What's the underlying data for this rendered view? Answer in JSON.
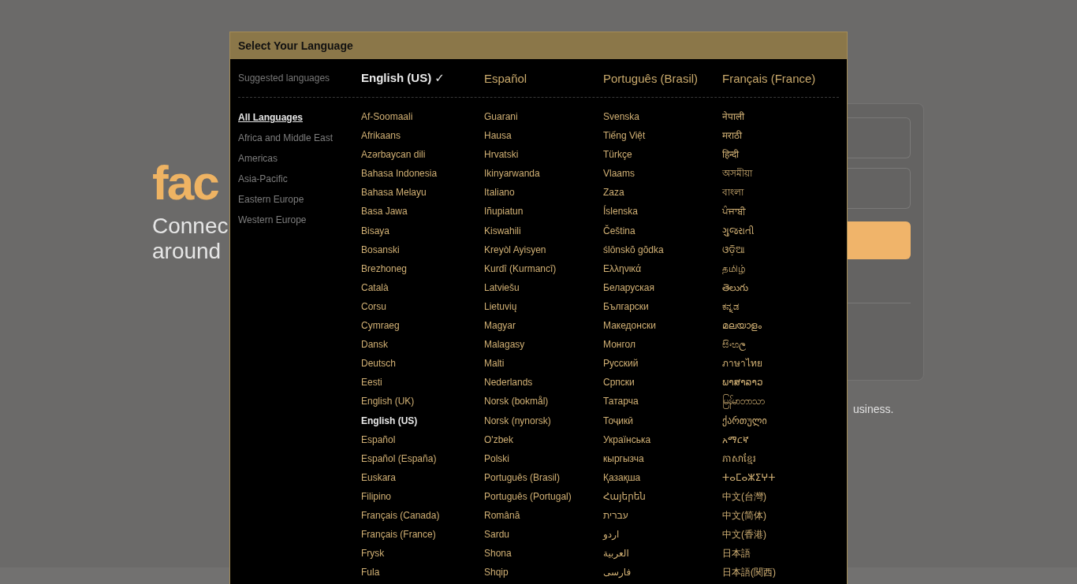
{
  "background": {
    "logo": "fac",
    "tagline": [
      "Connec",
      "around"
    ],
    "footer_text": "usiness."
  },
  "dialog": {
    "title": "Select Your Language",
    "suggested": {
      "label": "Suggested languages",
      "items": [
        {
          "label": "English (US) ✓",
          "selected": true
        },
        {
          "label": "Español",
          "selected": false
        },
        {
          "label": "Português (Brasil)",
          "selected": false
        },
        {
          "label": "Français (France)",
          "selected": false
        }
      ]
    },
    "sidebar": {
      "items": [
        {
          "label": "All Languages",
          "selected": true
        },
        {
          "label": "Africa and Middle East",
          "selected": false
        },
        {
          "label": "Americas",
          "selected": false
        },
        {
          "label": "Asia-Pacific",
          "selected": false
        },
        {
          "label": "Eastern Europe",
          "selected": false
        },
        {
          "label": "Western Europe",
          "selected": false
        }
      ]
    },
    "columns": [
      {
        "items": [
          {
            "label": "Af-Soomaali",
            "selected": false
          },
          {
            "label": "Afrikaans",
            "selected": false
          },
          {
            "label": "Azərbaycan dili",
            "selected": false
          },
          {
            "label": "Bahasa Indonesia",
            "selected": false
          },
          {
            "label": "Bahasa Melayu",
            "selected": false
          },
          {
            "label": "Basa Jawa",
            "selected": false
          },
          {
            "label": "Bisaya",
            "selected": false
          },
          {
            "label": "Bosanski",
            "selected": false
          },
          {
            "label": "Brezhoneg",
            "selected": false
          },
          {
            "label": "Català",
            "selected": false
          },
          {
            "label": "Corsu",
            "selected": false
          },
          {
            "label": "Cymraeg",
            "selected": false
          },
          {
            "label": "Dansk",
            "selected": false
          },
          {
            "label": "Deutsch",
            "selected": false
          },
          {
            "label": "Eesti",
            "selected": false
          },
          {
            "label": "English (UK)",
            "selected": false
          },
          {
            "label": "English (US)",
            "selected": true
          },
          {
            "label": "Español",
            "selected": false
          },
          {
            "label": "Español (España)",
            "selected": false
          },
          {
            "label": "Euskara",
            "selected": false
          },
          {
            "label": "Filipino",
            "selected": false
          },
          {
            "label": "Français (Canada)",
            "selected": false
          },
          {
            "label": "Français (France)",
            "selected": false
          },
          {
            "label": "Frysk",
            "selected": false
          },
          {
            "label": "Fula",
            "selected": false
          }
        ]
      },
      {
        "items": [
          {
            "label": "Guarani",
            "selected": false
          },
          {
            "label": "Hausa",
            "selected": false
          },
          {
            "label": "Hrvatski",
            "selected": false
          },
          {
            "label": "Ikinyarwanda",
            "selected": false
          },
          {
            "label": "Italiano",
            "selected": false
          },
          {
            "label": "Iñupiatun",
            "selected": false
          },
          {
            "label": "Kiswahili",
            "selected": false
          },
          {
            "label": "Kreyòl Ayisyen",
            "selected": false
          },
          {
            "label": "Kurdî (Kurmancî)",
            "selected": false
          },
          {
            "label": "Latviešu",
            "selected": false
          },
          {
            "label": "Lietuvių",
            "selected": false
          },
          {
            "label": "Magyar",
            "selected": false
          },
          {
            "label": "Malagasy",
            "selected": false
          },
          {
            "label": "Malti",
            "selected": false
          },
          {
            "label": "Nederlands",
            "selected": false
          },
          {
            "label": "Norsk (bokmål)",
            "selected": false
          },
          {
            "label": "Norsk (nynorsk)",
            "selected": false
          },
          {
            "label": "O'zbek",
            "selected": false
          },
          {
            "label": "Polski",
            "selected": false
          },
          {
            "label": "Português (Brasil)",
            "selected": false
          },
          {
            "label": "Português (Portugal)",
            "selected": false
          },
          {
            "label": "Română",
            "selected": false
          },
          {
            "label": "Sardu",
            "selected": false
          },
          {
            "label": "Shona",
            "selected": false
          },
          {
            "label": "Shqip",
            "selected": false
          }
        ]
      },
      {
        "items": [
          {
            "label": "Svenska",
            "selected": false
          },
          {
            "label": "Tiếng Việt",
            "selected": false
          },
          {
            "label": "Türkçe",
            "selected": false
          },
          {
            "label": "Vlaams",
            "selected": false
          },
          {
            "label": "Zaza",
            "selected": false
          },
          {
            "label": "Íslenska",
            "selected": false
          },
          {
            "label": "Čeština",
            "selected": false
          },
          {
            "label": "ślōnskŏ gŏdka",
            "selected": false
          },
          {
            "label": "Ελληνικά",
            "selected": false
          },
          {
            "label": "Беларуская",
            "selected": false
          },
          {
            "label": "Български",
            "selected": false
          },
          {
            "label": "Македонски",
            "selected": false
          },
          {
            "label": "Монгол",
            "selected": false
          },
          {
            "label": "Русский",
            "selected": false
          },
          {
            "label": "Српски",
            "selected": false
          },
          {
            "label": "Татарча",
            "selected": false
          },
          {
            "label": "Тоҷикӣ",
            "selected": false
          },
          {
            "label": "Українська",
            "selected": false
          },
          {
            "label": "кыргызча",
            "selected": false
          },
          {
            "label": "Қазақша",
            "selected": false
          },
          {
            "label": "Հայերեն",
            "selected": false
          },
          {
            "label": "עברית",
            "selected": false
          },
          {
            "label": "اردو",
            "selected": false
          },
          {
            "label": "العربية",
            "selected": false
          },
          {
            "label": "فارسی",
            "selected": false
          }
        ]
      },
      {
        "items": [
          {
            "label": "नेपाली",
            "selected": false
          },
          {
            "label": "मराठी",
            "selected": false
          },
          {
            "label": "हिन्दी",
            "selected": false
          },
          {
            "label": "অসমীয়া",
            "selected": false
          },
          {
            "label": "বাংলা",
            "selected": false
          },
          {
            "label": "ਪੰਜਾਬੀ",
            "selected": false
          },
          {
            "label": "ગુજરાતી",
            "selected": false
          },
          {
            "label": "ଓଡ଼ିଆ",
            "selected": false
          },
          {
            "label": "தமிழ்",
            "selected": false
          },
          {
            "label": "తెలుగు",
            "selected": false
          },
          {
            "label": "ಕನ್ನಡ",
            "selected": false
          },
          {
            "label": "മലയാളം",
            "selected": false
          },
          {
            "label": "සිංහල",
            "selected": false
          },
          {
            "label": "ภาษาไทย",
            "selected": false
          },
          {
            "label": "ພາສາລາວ",
            "selected": false
          },
          {
            "label": "မြန်မာဘာသာ",
            "selected": false
          },
          {
            "label": "ქართული",
            "selected": false
          },
          {
            "label": "አማርኛ",
            "selected": false
          },
          {
            "label": "ភាសាខ្មែរ",
            "selected": false
          },
          {
            "label": "ⵜⴰⵎⴰⵣⵉⵖⵜ",
            "selected": false
          },
          {
            "label": "中文(台灣)",
            "selected": false
          },
          {
            "label": "中文(简体)",
            "selected": false
          },
          {
            "label": "中文(香港)",
            "selected": false
          },
          {
            "label": "日本語",
            "selected": false
          },
          {
            "label": "日本語(関西)",
            "selected": false
          }
        ]
      }
    ]
  }
}
